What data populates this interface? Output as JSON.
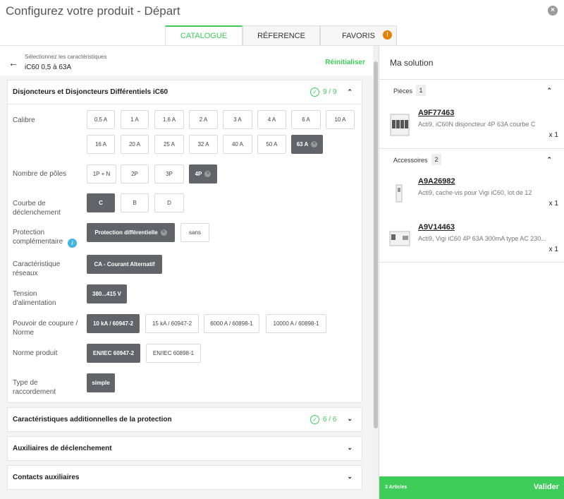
{
  "header": {
    "title": "Configurez votre produit - Départ",
    "close_glyph": "×"
  },
  "tabs": [
    {
      "label": "CATALOGUE",
      "active": true
    },
    {
      "label": "RÉFERENCE"
    },
    {
      "label": "FAVORIS",
      "badge": "!"
    }
  ],
  "breadcrumb": {
    "subtitle": "Sélectionnez les caractéristiques",
    "title": "iC60 0,5 à 63A",
    "reset": "Réinitialiser"
  },
  "sections": [
    {
      "title": "Disjoncteurs et Disjoncteurs Différentiels iC60",
      "count": "9 / 9",
      "expanded": true
    },
    {
      "title": "Caractéristiques additionnelles de la protection",
      "count": "6 / 6"
    },
    {
      "title": "Auxiliaires de déclenchement"
    },
    {
      "title": "Contacts auxiliaires"
    }
  ],
  "features": {
    "calibre": {
      "label": "Calibre",
      "options": [
        "0.5 A",
        "1 A",
        "1.6 A",
        "2 A",
        "3 A",
        "4 A",
        "6 A",
        "10 A",
        "16 A",
        "20 A",
        "25 A",
        "32 A",
        "40 A",
        "50 A",
        "63 A"
      ],
      "selected": "63 A"
    },
    "poles": {
      "label": "Nombre de pôles",
      "options": [
        "1P + N",
        "2P",
        "3P",
        "4P"
      ],
      "selected": "4P"
    },
    "courbe": {
      "label": "Courbe de déclenchement",
      "options": [
        "C",
        "B",
        "D"
      ],
      "selected": "C"
    },
    "protection": {
      "label": "Protection complémentaire",
      "options": [
        "Protection différentielle",
        "sans"
      ],
      "selected": "Protection différentielle"
    },
    "reseau": {
      "label": "Caractéristique réseaux",
      "options": [
        "CA - Courant Alternatif"
      ],
      "selected": "CA - Courant Alternatif"
    },
    "tension": {
      "label": "Tension d'alimentation",
      "options": [
        "380...415 V"
      ],
      "selected": "380...415 V"
    },
    "pouvoir": {
      "label": "Pouvoir de coupure / Norme",
      "options": [
        "10 kA / 60947-2",
        "15 kA / 60947-2",
        "6000 A / 60898-1",
        "10000 A / 60898-1"
      ],
      "selected": "10 kA / 60947-2"
    },
    "norme": {
      "label": "Norme produit",
      "options": [
        "EN/IEC 60947-2",
        "EN/IEC 60898-1"
      ],
      "selected": "EN/IEC 60947-2"
    },
    "raccordement": {
      "label": "Type de raccordement",
      "options": [
        "simple"
      ],
      "selected": "simple"
    }
  },
  "solution": {
    "title": "Ma solution",
    "pieces": {
      "label": "Pièces",
      "count": "1",
      "items": [
        {
          "ref": "A9F77463",
          "desc": "Acti9, iC60N disjoncteur 4P 63A courbe C",
          "qty": "x 1"
        }
      ]
    },
    "accessoires": {
      "label": "Accessoires",
      "count": "2",
      "items": [
        {
          "ref": "A9A26982",
          "desc": "Acti9, cache-vis pour Vigi iC60, lot de 12",
          "qty": "x 1"
        },
        {
          "ref": "A9V14463",
          "desc": "Acti9, Vigi iC60 4P 63A 300mA type AC 230...",
          "qty": "x 1"
        }
      ]
    },
    "footer": {
      "articles": "3 Articles",
      "validate": "Valider"
    }
  },
  "colors": {
    "accent": "#3dcd58",
    "selected": "#626469",
    "badge": "#e47f00",
    "info": "#42b4e6"
  },
  "icons": {
    "back": "arrow-left-icon",
    "check": "check-circle-icon",
    "chevron": "chevron-icon",
    "info": "info-icon",
    "close": "close-icon"
  }
}
